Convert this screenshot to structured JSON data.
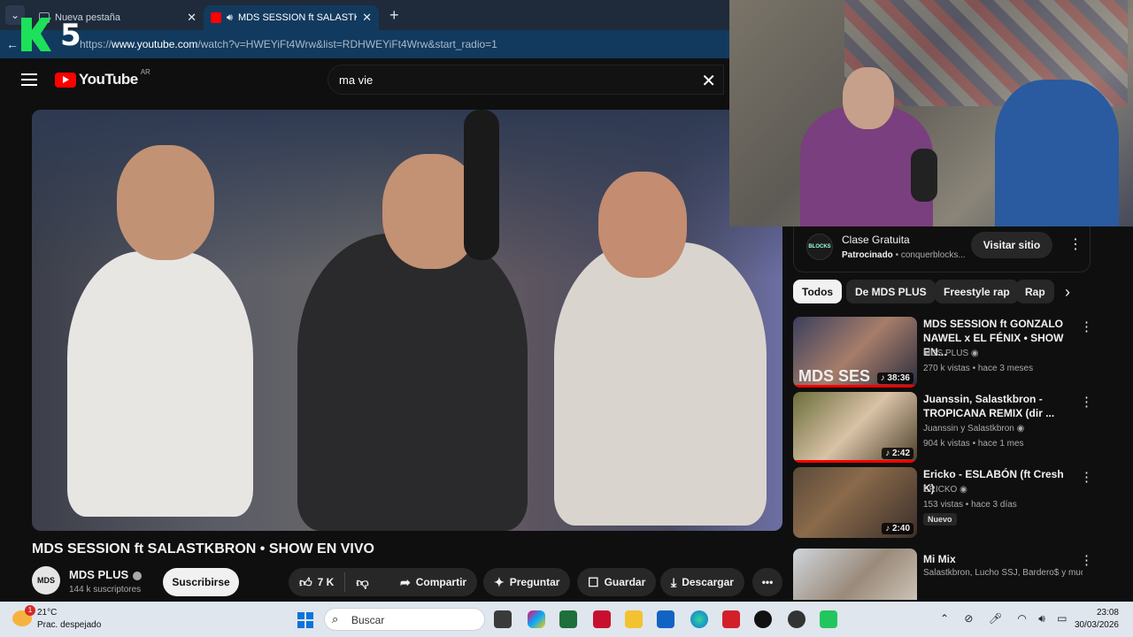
{
  "browser": {
    "tabs": [
      {
        "title": "Nueva pestaña",
        "active": false
      },
      {
        "title": "MDS SESSION ft SALASTKBRO",
        "active": true
      }
    ],
    "url_prefix": "https://",
    "url_host": "www.youtube.com",
    "url_path": "/watch?v=HWEYiFt4Wrw&list=RDHWEYiFt4Wrw&start_radio=1"
  },
  "overlay": {
    "logo_text": "5"
  },
  "youtube": {
    "logo_word": "YouTube",
    "country_code": "AR",
    "search_query": "ma vie",
    "video": {
      "title": "MDS SESSION ft SALASTKBRON • SHOW EN VIVO",
      "channel": "MDS PLUS",
      "subscribers": "144 k suscriptores",
      "subscribe_label": "Suscribirse",
      "likes": "7 K",
      "share_label": "Compartir",
      "ask_label": "Preguntar",
      "save_label": "Guardar",
      "download_label": "Descargar",
      "channel_avatar_text": "MDS"
    },
    "ad": {
      "logo_text": "BLOCKS",
      "title": "Clase Gratuita",
      "sponsored": "Patrocinado",
      "domain": "• conquerblocks...",
      "visit_label": "Visitar sitio"
    },
    "chips": [
      "Todos",
      "De MDS PLUS",
      "Freestyle rap",
      "Rap"
    ],
    "recommendations": [
      {
        "title": "MDS SESSION ft GONZALO NAWEL x EL FÉNIX • SHOW EN...",
        "channel": "MDS PLUS",
        "meta": "270 k vistas • hace 3 meses",
        "duration": "38:36",
        "badge": ""
      },
      {
        "title": "Juanssin, Salastkbron - TROPICANA REMIX  (dir ...",
        "channel": "Juanssin y Salastkbron",
        "meta": "904 k vistas • hace 1 mes",
        "duration": "2:42",
        "badge": ""
      },
      {
        "title": "Ericko - ESLABÓN (ft Cresh K)",
        "channel": "ERICKO",
        "meta": "153 vistas • hace 3 días",
        "duration": "2:40",
        "badge": "Nuevo"
      },
      {
        "title": "Mi Mix",
        "channel": "Salastkbron, Lucho SSJ, Bardero$ y muc...",
        "meta": "",
        "duration": "",
        "badge": ""
      }
    ],
    "thumb_overlay_text": "MDS SES"
  },
  "taskbar": {
    "temperature": "21°C",
    "weather": "Prac. despejado",
    "weather_badge": "1",
    "search_label": "Buscar",
    "time": "23:08",
    "date": "30/03/2026"
  },
  "colors": {
    "yt_red": "#ff0000",
    "bg": "#0f0f0f",
    "chip": "#272727",
    "k5_green": "#1de15a"
  }
}
